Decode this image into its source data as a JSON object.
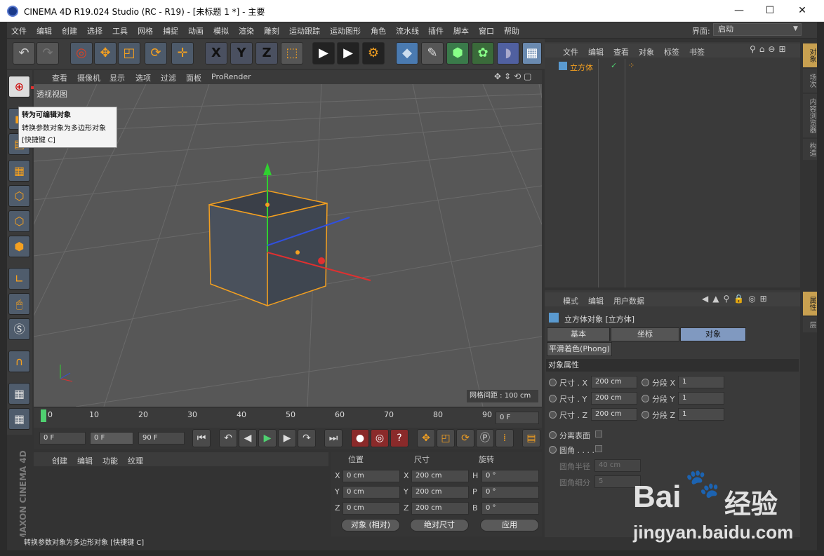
{
  "window": {
    "title": "CINEMA 4D R19.024 Studio (RC - R19) - [未标题 1 *] - 主要",
    "minimize": "—",
    "maximize": "☐",
    "close": "✕"
  },
  "menu": {
    "items": [
      "文件",
      "编辑",
      "创建",
      "选择",
      "工具",
      "网格",
      "捕捉",
      "动画",
      "模拟",
      "渲染",
      "雕刻",
      "运动跟踪",
      "运动图形",
      "角色",
      "流水线",
      "插件",
      "脚本",
      "窗口",
      "帮助"
    ],
    "layout_label": "界面:",
    "layout_value": "启动"
  },
  "toolbar": {
    "icons": [
      "undo-icon",
      "redo-icon",
      "live-select-icon",
      "move-icon",
      "scale-icon",
      "rotate-icon",
      "last-tool-icon",
      "x-axis-icon",
      "y-axis-icon",
      "z-axis-icon",
      "coordinate-system-icon",
      "render-view-icon",
      "render-picture-viewer-icon",
      "render-settings-icon",
      "cube-icon",
      "pen-icon",
      "subdivision-icon",
      "cloner-icon",
      "deformer-icon",
      "floor-icon"
    ],
    "axis_x": "X",
    "axis_y": "Y",
    "axis_z": "Z"
  },
  "viewport": {
    "menu": [
      "查看",
      "摄像机",
      "显示",
      "选项",
      "过滤",
      "面板",
      "ProRender"
    ],
    "label": "透视视图",
    "grid_info": "网格间距 : 100 cm"
  },
  "tooltip": {
    "title": "转为可编辑对象",
    "desc": "转换参数对象为多边形对象",
    "shortcut": "[快捷键 C]"
  },
  "timeline": {
    "ticks": [
      "0",
      "10",
      "20",
      "30",
      "40",
      "50",
      "60",
      "70",
      "80",
      "90"
    ],
    "current": "0 F"
  },
  "transport": {
    "start": "0 F",
    "min": "0 F",
    "max": "90 F"
  },
  "materials": {
    "menu": [
      "创建",
      "编辑",
      "功能",
      "纹理"
    ]
  },
  "coords": {
    "headers": [
      "位置",
      "尺寸",
      "旋转"
    ],
    "rows": [
      {
        "a": "X",
        "pos": "0 cm",
        "b": "X",
        "size": "200 cm",
        "c": "H",
        "rot": "0 °"
      },
      {
        "a": "Y",
        "pos": "0 cm",
        "b": "Y",
        "size": "200 cm",
        "c": "P",
        "rot": "0 °"
      },
      {
        "a": "Z",
        "pos": "0 cm",
        "b": "Z",
        "size": "200 cm",
        "c": "B",
        "rot": "0 °"
      }
    ],
    "mode": "对象 (相对)",
    "size_mode": "绝对尺寸",
    "apply": "应用"
  },
  "objects": {
    "menu": [
      "文件",
      "编辑",
      "查看",
      "对象",
      "标签",
      "书签"
    ],
    "item": "立方体"
  },
  "attributes": {
    "menu": [
      "模式",
      "编辑",
      "用户数据"
    ],
    "title": "立方体对象 [立方体]",
    "tabs": [
      "基本",
      "坐标",
      "对象"
    ],
    "phong": "平滑着色(Phong)",
    "section": "对象属性",
    "rows": [
      {
        "l": "尺寸 . X",
        "v": "200 cm",
        "l2": "分段 X",
        "v2": "1"
      },
      {
        "l": "尺寸 . Y",
        "v": "200 cm",
        "l2": "分段 Y",
        "v2": "1"
      },
      {
        "l": "尺寸 . Z",
        "v": "200 cm",
        "l2": "分段 Z",
        "v2": "1"
      }
    ],
    "sep": "分离表面",
    "fillet": "圆角 . . . .",
    "fillet_r": "圆角半径",
    "fillet_r_v": "40 cm",
    "fillet_s": "圆角细分",
    "fillet_s_v": "5"
  },
  "side_tabs": [
    "对象",
    "场次",
    "内容浏览器",
    "构造",
    "属性",
    "层"
  ],
  "status": "转换参数对象为多边形对象 [快捷键 C]",
  "brand": "MAXON CINEMA 4D",
  "watermark": {
    "logo": "Bai",
    "logo2": "经验",
    "url": "jingyan.baidu.com"
  }
}
